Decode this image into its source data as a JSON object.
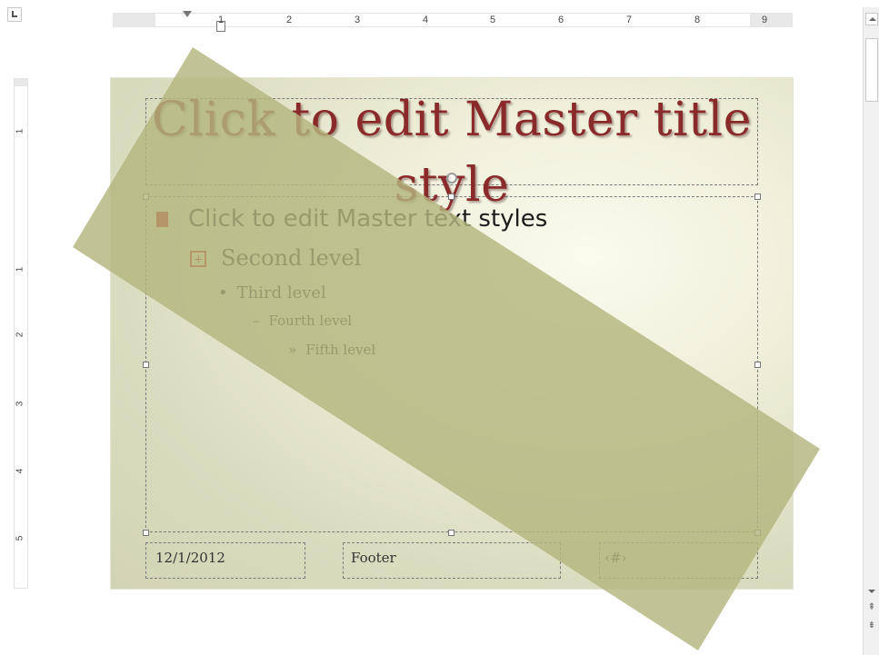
{
  "ruler": {
    "numbers": [
      "1",
      "2",
      "3",
      "4",
      "5",
      "6",
      "7",
      "8",
      "9"
    ],
    "vnumbers": [
      "1",
      "1",
      "2",
      "3",
      "4",
      "5"
    ]
  },
  "slide": {
    "title": "Click to edit Master title style",
    "body": {
      "level1": "Click to edit Master text styles",
      "level2": "Second level",
      "level3": "Third level",
      "level4": "Fourth level",
      "level5": "Fifth level"
    },
    "date": "12/1/2012",
    "footer": "Footer",
    "slide_number": "‹#›",
    "bullets": {
      "l3": "•",
      "l4": "–",
      "l5": "»"
    }
  },
  "colors": {
    "title": "#8a2a2a",
    "bullet": "#c00000",
    "diagonal_band": "#b5b88a"
  }
}
